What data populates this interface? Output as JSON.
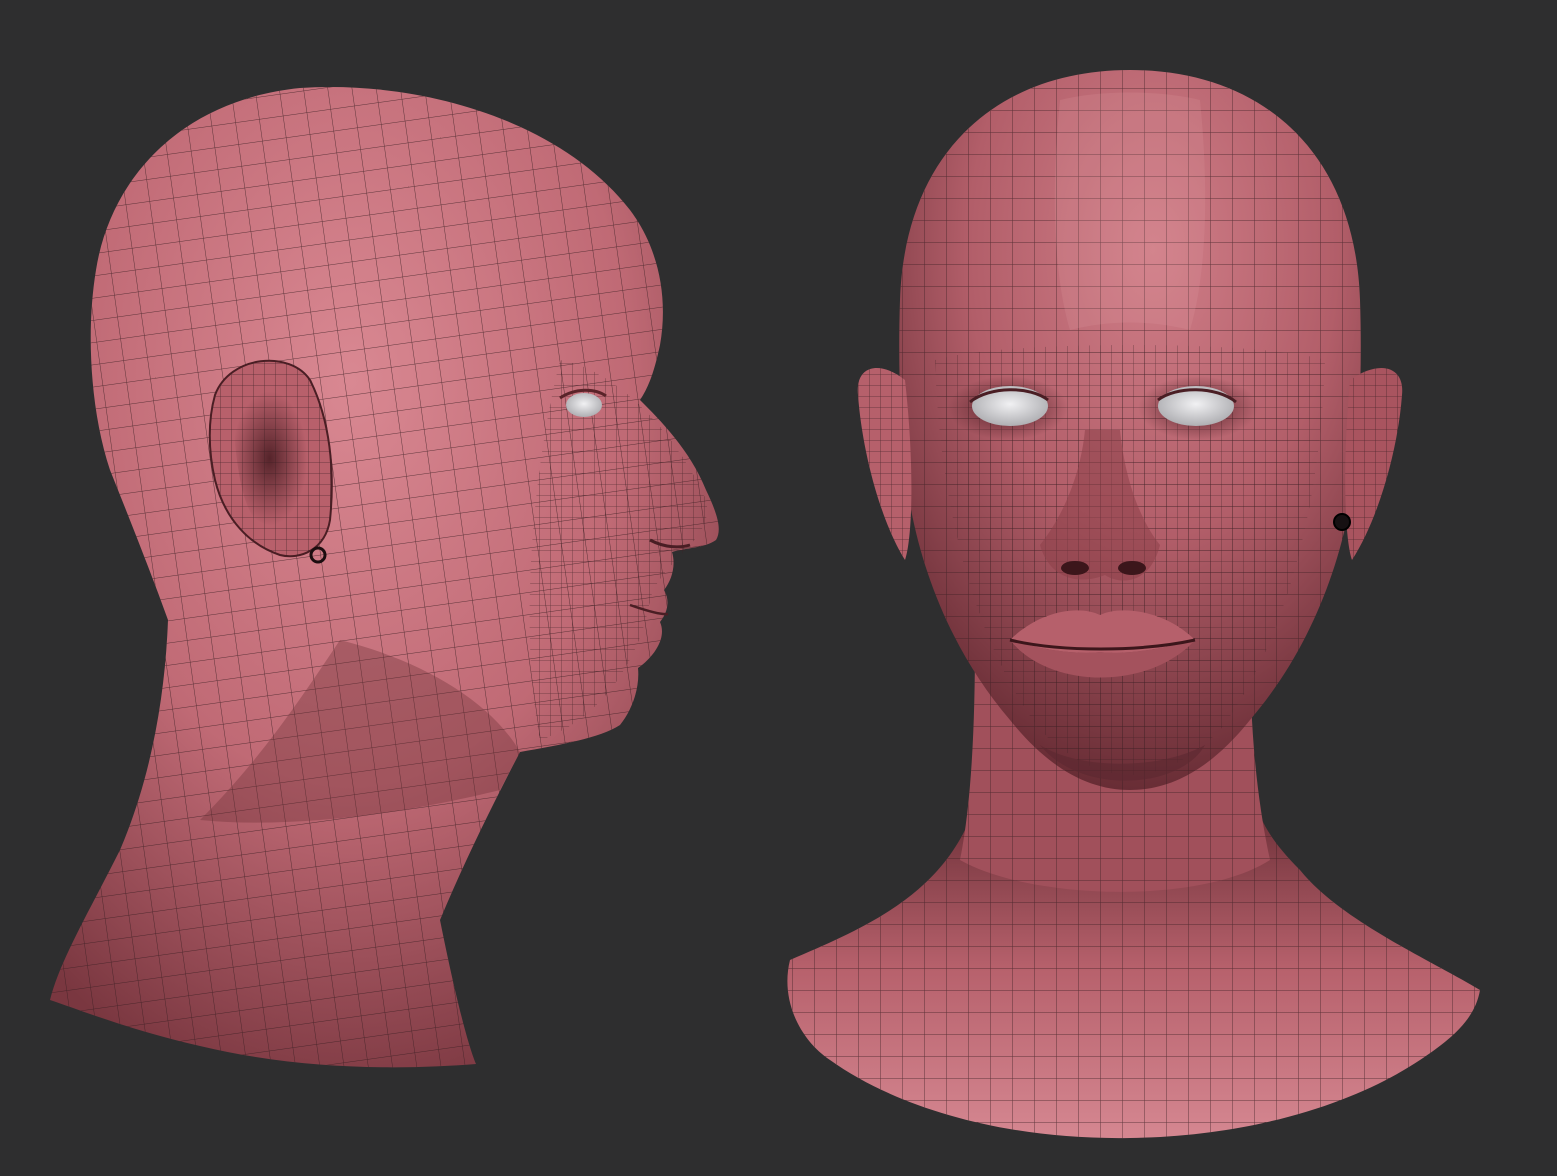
{
  "scene": {
    "background_color": "#2e2e2f",
    "skin_color": "#c8727c",
    "skin_highlight": "#dc8e97",
    "skin_shadow": "#6e3038",
    "wire_color": "#3a1e22",
    "eye_color": "#e4e4e6",
    "views": [
      {
        "name": "side-profile-view",
        "facing": "right"
      },
      {
        "name": "front-view",
        "facing": "viewer"
      }
    ]
  }
}
